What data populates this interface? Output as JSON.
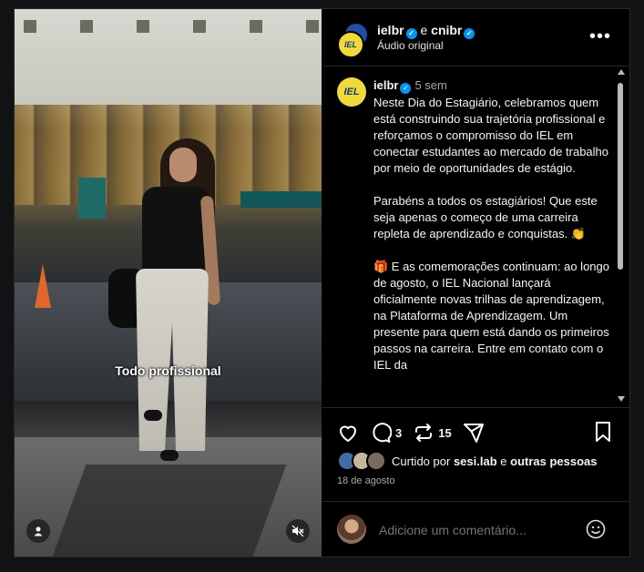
{
  "header": {
    "user1": "ielbr",
    "joiner": "e",
    "user2": "cnibr",
    "audio": "Áudio original",
    "more_icon": "more-horizontal-icon"
  },
  "avatar_text": "IEL",
  "video": {
    "caption": "Todo profissional"
  },
  "post": {
    "username": "ielbr",
    "time": "5 sem",
    "paragraphs": [
      "Neste Dia do Estagiário, celebramos quem está construindo sua trajetória profissional e reforçamos o compromisso do IEL em conectar estudantes ao mercado de trabalho por meio de oportunidades de estágio.",
      "Parabéns a todos os estagiários! Que este seja apenas o começo de uma carreira repleta de aprendizado e conquistas. 👏",
      "🎁 E as comemorações continuam: ao longo de agosto, o IEL Nacional lançará oficialmente novas trilhas de aprendizagem, na Plataforma de Aprendizagem. Um presente para quem está dando os primeiros passos na carreira. Entre em contato com o IEL da"
    ]
  },
  "actions": {
    "comment_count": "3",
    "repost_count": "15"
  },
  "likes": {
    "prefix": "Curtido por",
    "user": "sesi.lab",
    "joiner": "e",
    "others": "outras pessoas"
  },
  "date": "18 de agosto",
  "comment_box": {
    "placeholder": "Adicione um comentário..."
  },
  "colors": {
    "background": "#000000",
    "verified": "#0095f6",
    "iel_yellow": "#f2d93a"
  }
}
